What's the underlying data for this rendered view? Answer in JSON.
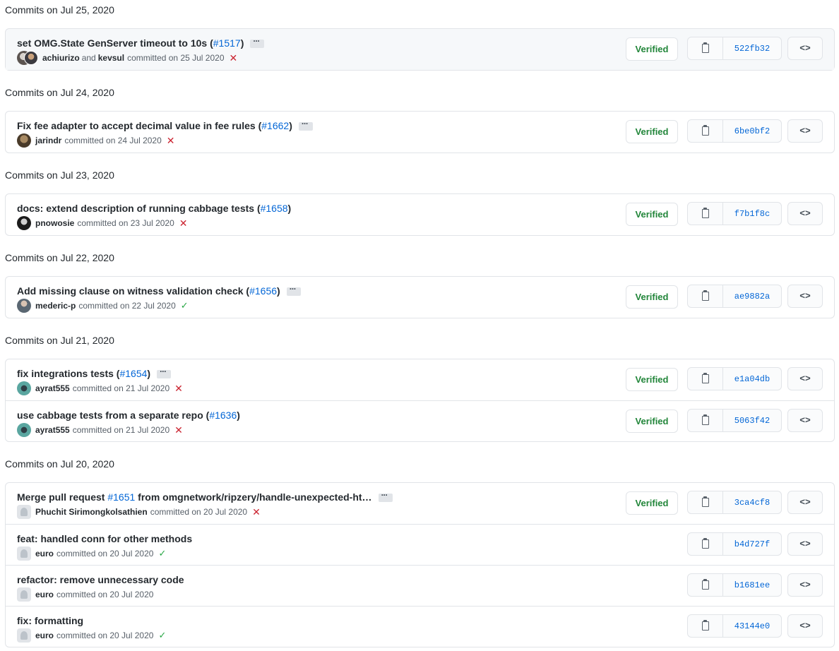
{
  "groups": [
    {
      "heading": "Commits on Jul 25, 2020",
      "commits": [
        {
          "title_pre": "set OMG.State GenServer timeout to 10s (",
          "pr": "#1517",
          "title_post": ")",
          "ellipsis": true,
          "authors": [
            "achiurizo",
            "kevsul"
          ],
          "joiner": "and",
          "committed": "committed on 25 Jul 2020",
          "status": "fail",
          "status_glyph": "✕",
          "verified": "Verified",
          "sha": "522fb32",
          "avatar": "pair"
        }
      ]
    },
    {
      "heading": "Commits on Jul 24, 2020",
      "commits": [
        {
          "title_pre": "Fix fee adapter to accept decimal value in fee rules (",
          "pr": "#1662",
          "title_post": ")",
          "ellipsis": true,
          "authors": [
            "jarindr"
          ],
          "committed": "committed on 24 Jul 2020",
          "status": "fail",
          "status_glyph": "✕",
          "verified": "Verified",
          "sha": "6be0bf2",
          "avatar": "photo-brown"
        }
      ]
    },
    {
      "heading": "Commits on Jul 23, 2020",
      "commits": [
        {
          "title_pre": "docs: extend description of running cabbage tests (",
          "pr": "#1658",
          "title_post": ")",
          "ellipsis": false,
          "authors": [
            "pnowosie"
          ],
          "committed": "committed on 23 Jul 2020",
          "status": "fail",
          "status_glyph": "✕",
          "verified": "Verified",
          "sha": "f7b1f8c",
          "avatar": "photo-dark"
        }
      ]
    },
    {
      "heading": "Commits on Jul 22, 2020",
      "commits": [
        {
          "title_pre": "Add missing clause on witness validation check (",
          "pr": "#1656",
          "title_post": ")",
          "ellipsis": true,
          "authors": [
            "mederic-p"
          ],
          "committed": "committed on 22 Jul 2020",
          "status": "ok",
          "status_glyph": "✓",
          "verified": "Verified",
          "sha": "ae9882a",
          "avatar": "photo-gray"
        }
      ]
    },
    {
      "heading": "Commits on Jul 21, 2020",
      "commits": [
        {
          "title_pre": "fix integrations tests (",
          "pr": "#1654",
          "title_post": ")",
          "ellipsis": true,
          "authors": [
            "ayrat555"
          ],
          "committed": "committed on 21 Jul 2020",
          "status": "fail",
          "status_glyph": "✕",
          "verified": "Verified",
          "sha": "e1a04db",
          "avatar": "photo-teal"
        },
        {
          "title_pre": "use cabbage tests from a separate repo (",
          "pr": "#1636",
          "title_post": ")",
          "ellipsis": false,
          "authors": [
            "ayrat555"
          ],
          "committed": "committed on 21 Jul 2020",
          "status": "fail",
          "status_glyph": "✕",
          "verified": "Verified",
          "sha": "5063f42",
          "avatar": "photo-teal"
        }
      ]
    },
    {
      "heading": "Commits on Jul 20, 2020",
      "commits": [
        {
          "title_pre": "Merge pull request ",
          "pr": "#1651",
          "title_post": " from omgnetwork/ripzery/handle-unexpected-ht…",
          "ellipsis": true,
          "authors": [
            "Phuchit Sirimongkolsathien"
          ],
          "committed": "committed on 20 Jul 2020",
          "status": "fail",
          "status_glyph": "✕",
          "verified": "Verified",
          "sha": "3ca4cf8",
          "avatar": "default"
        },
        {
          "title_pre": "feat: handled conn for other methods",
          "pr": "",
          "title_post": "",
          "ellipsis": false,
          "authors": [
            "euro"
          ],
          "committed": "committed on 20 Jul 2020",
          "status": "ok",
          "status_glyph": "✓",
          "verified": "",
          "sha": "b4d727f",
          "avatar": "default"
        },
        {
          "title_pre": "refactor: remove unnecessary code",
          "pr": "",
          "title_post": "",
          "ellipsis": false,
          "authors": [
            "euro"
          ],
          "committed": "committed on 20 Jul 2020",
          "status": "none",
          "status_glyph": "",
          "verified": "",
          "sha": "b1681ee",
          "avatar": "default"
        },
        {
          "title_pre": "fix: formatting",
          "pr": "",
          "title_post": "",
          "ellipsis": false,
          "authors": [
            "euro"
          ],
          "committed": "committed on 20 Jul 2020",
          "status": "ok",
          "status_glyph": "✓",
          "verified": "",
          "sha": "43144e0",
          "avatar": "default"
        }
      ]
    }
  ],
  "browse_glyph": "<>",
  "colors": {
    "link": "#0366d6",
    "verified": "#22863a",
    "fail": "#cb2431",
    "ok": "#28a745",
    "border": "#e1e4e8"
  }
}
